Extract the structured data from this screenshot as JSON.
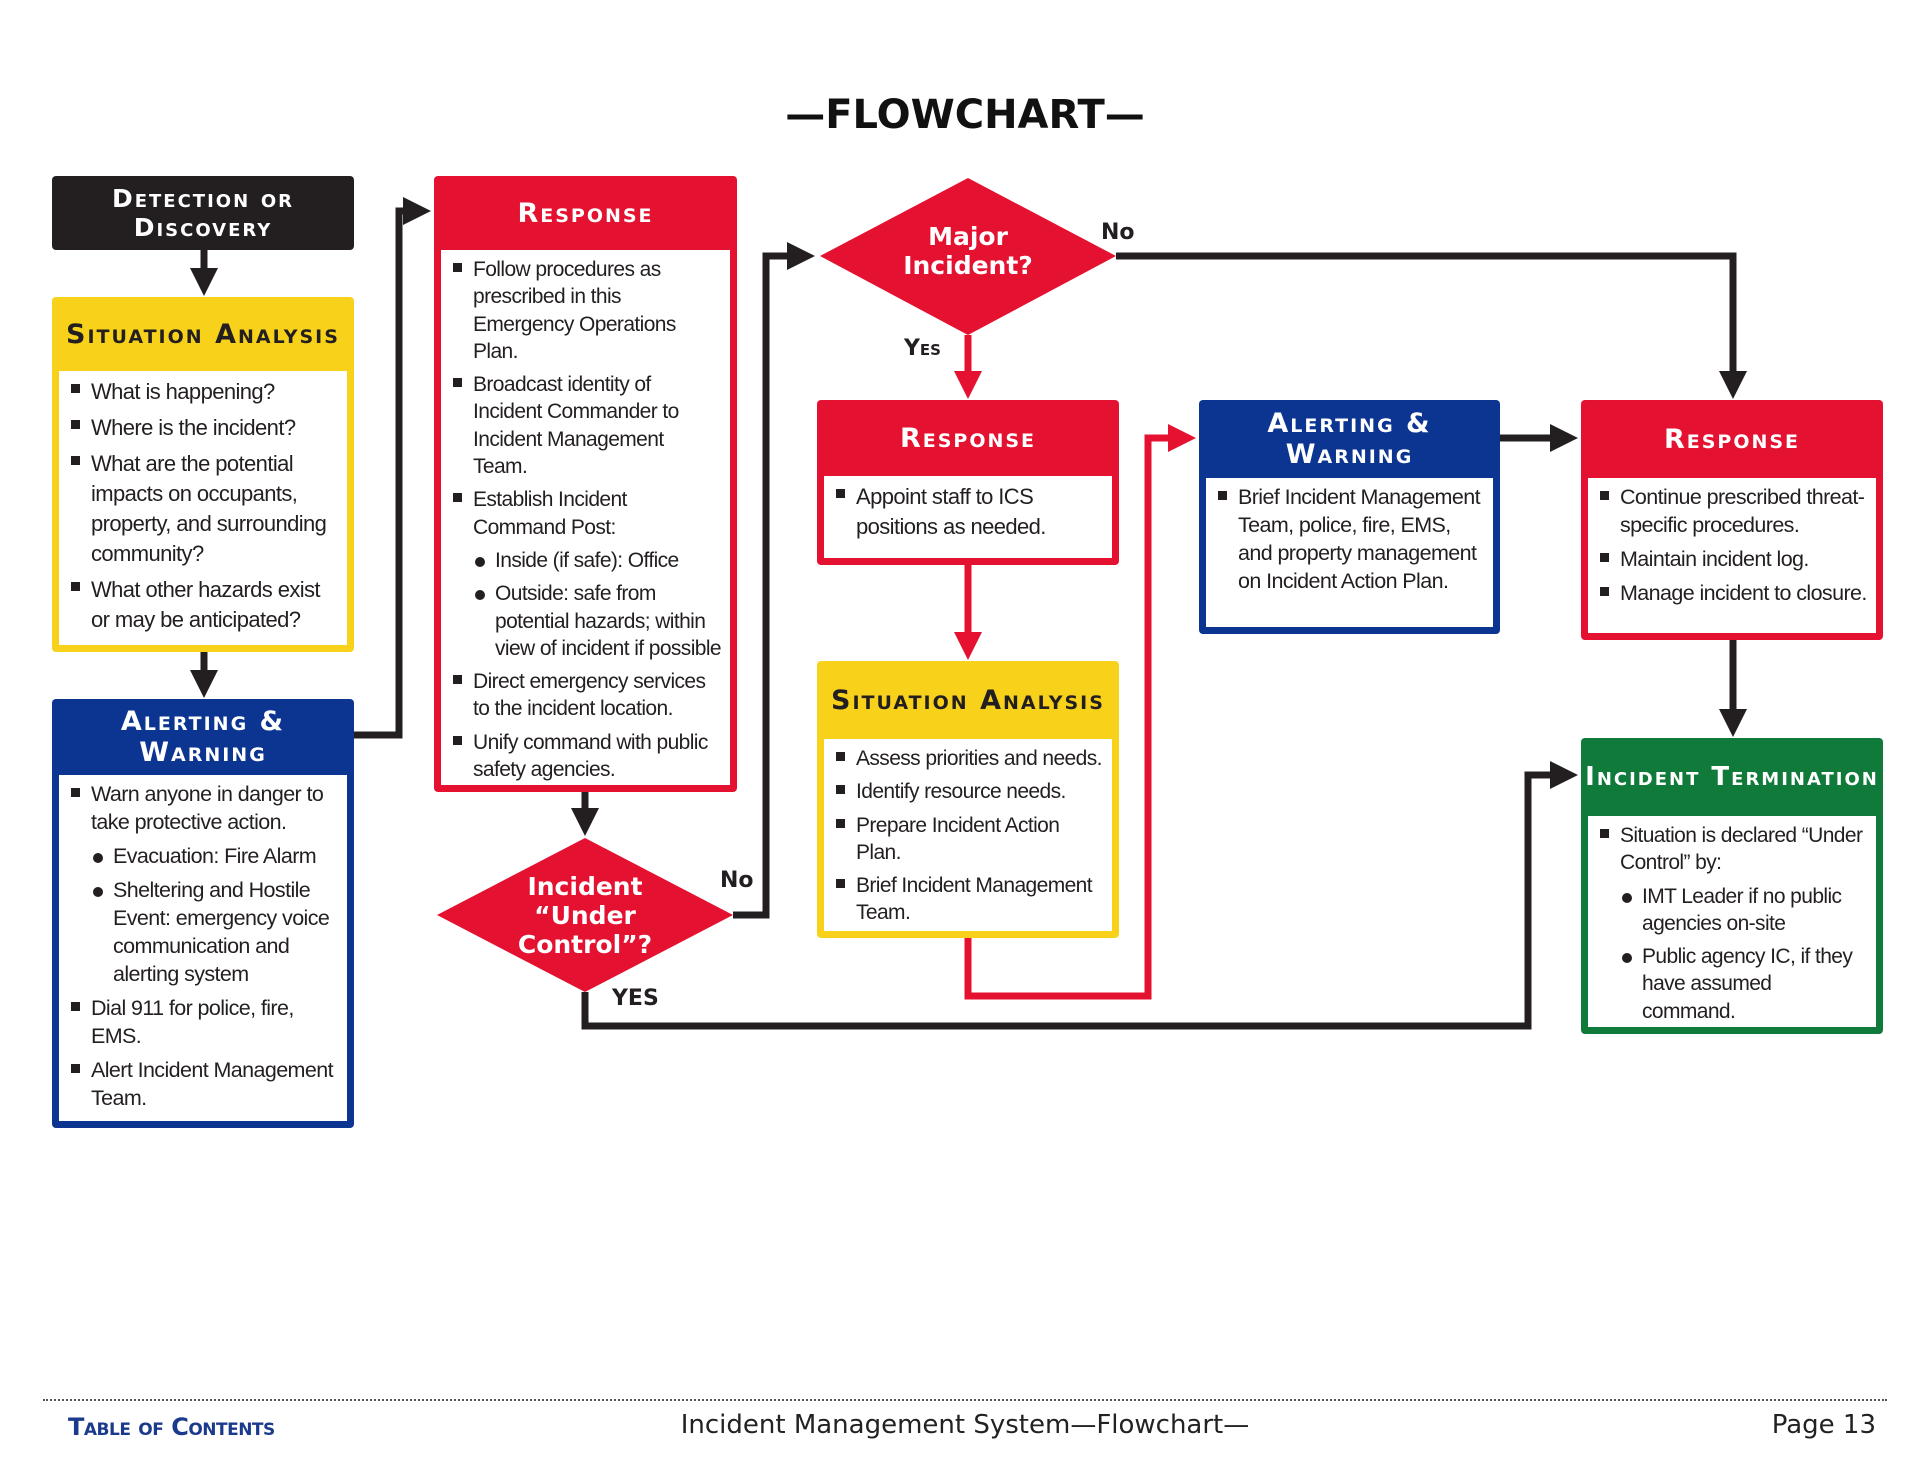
{
  "page": {
    "title": "—FLOWCHART—",
    "footer": {
      "toc_link": "Table of Contents",
      "center_text": "Incident Management System—Flowchart—",
      "page_label": "Page 13"
    }
  },
  "colors": {
    "black": "#231f20",
    "yellow": "#f8d11a",
    "blue": "#0c3591",
    "red": "#e41131",
    "green": "#0f7a3a",
    "toc_link": "#1b3a8c"
  },
  "nodes": {
    "detection": {
      "title": "Detection or Discovery"
    },
    "situation1": {
      "title": "Situation Analysis",
      "items": [
        {
          "type": "square",
          "text": "What is happening?"
        },
        {
          "type": "square",
          "text": "Where is the incident?"
        },
        {
          "type": "square",
          "text": "What are the potential impacts on occupants, property, and surrounding community?"
        },
        {
          "type": "square",
          "text": "What other hazards exist or may be anticipated?"
        }
      ]
    },
    "alerting1": {
      "title": "Alerting & Warning",
      "items": [
        {
          "type": "square",
          "text": "Warn anyone in danger to take protective action."
        },
        {
          "type": "dot",
          "text": "Evacuation: Fire Alarm"
        },
        {
          "type": "dot",
          "text": "Sheltering and Hostile Event: emergency voice communication and alerting system"
        },
        {
          "type": "square",
          "text": "Dial 911 for police, fire, EMS."
        },
        {
          "type": "square",
          "text": "Alert Incident Management Team."
        }
      ]
    },
    "response1": {
      "title": "Response",
      "items": [
        {
          "type": "square",
          "text": "Follow procedures as prescribed in this Emergency Operations Plan."
        },
        {
          "type": "square",
          "text": "Broadcast identity of Incident Commander to Incident Management Team."
        },
        {
          "type": "square",
          "text": "Establish Incident Command Post:"
        },
        {
          "type": "dot",
          "text": "Inside (if safe): Office"
        },
        {
          "type": "dot",
          "text": "Outside: safe from potential hazards; within view of incident if possible"
        },
        {
          "type": "square",
          "text": "Direct emergency services to the incident location."
        },
        {
          "type": "square",
          "text": "Unify command with public safety agencies."
        }
      ]
    },
    "decision_control": {
      "line1": "Incident",
      "line2": "“Under",
      "line3": "Control”?",
      "no_label": "No",
      "yes_label": "YES"
    },
    "decision_major": {
      "line1": "Major",
      "line2": "Incident?",
      "no_label": "No",
      "yes_label": "Yes"
    },
    "response2": {
      "title": "Response",
      "items": [
        {
          "type": "square",
          "text": "Appoint staff to ICS positions as needed."
        }
      ]
    },
    "situation2": {
      "title": "Situation Analysis",
      "items": [
        {
          "type": "square",
          "text": "Assess priorities and needs."
        },
        {
          "type": "square",
          "text": "Identify resource needs."
        },
        {
          "type": "square",
          "text": "Prepare Incident Action Plan."
        },
        {
          "type": "square",
          "text": "Brief Incident Management Team."
        }
      ]
    },
    "alerting2": {
      "title": "Alerting & Warning",
      "items": [
        {
          "type": "square",
          "text": "Brief Incident Management Team, police, fire, EMS, and property management on Incident Action Plan."
        }
      ]
    },
    "response3": {
      "title": "Response",
      "items": [
        {
          "type": "square",
          "text": "Continue prescribed threat-specific procedures."
        },
        {
          "type": "square",
          "text": "Maintain incident log."
        },
        {
          "type": "square",
          "text": "Manage incident to closure."
        }
      ]
    },
    "termination": {
      "title": "Incident Termination",
      "items": [
        {
          "type": "square",
          "text": "Situation is declared “Under Control” by:"
        },
        {
          "type": "dot",
          "text": "IMT Leader if no public agencies on-site"
        },
        {
          "type": "dot",
          "text": "Public agency IC, if they have assumed command."
        }
      ]
    }
  },
  "edges": [
    {
      "from": "detection",
      "to": "situation1"
    },
    {
      "from": "situation1",
      "to": "alerting1"
    },
    {
      "from": "alerting1",
      "to": "response1"
    },
    {
      "from": "response1",
      "to": "decision_control"
    },
    {
      "from": "decision_control",
      "to": "decision_major",
      "label": "No"
    },
    {
      "from": "decision_control",
      "to": "termination",
      "label": "YES"
    },
    {
      "from": "decision_major",
      "to": "response2",
      "label": "Yes"
    },
    {
      "from": "decision_major",
      "to": "response3",
      "label": "No"
    },
    {
      "from": "response2",
      "to": "situation2"
    },
    {
      "from": "situation2",
      "to": "alerting2"
    },
    {
      "from": "alerting2",
      "to": "response3"
    },
    {
      "from": "response3",
      "to": "termination"
    }
  ]
}
